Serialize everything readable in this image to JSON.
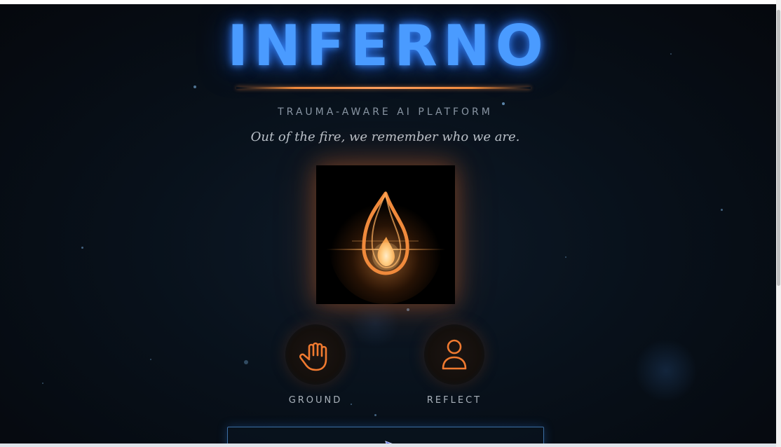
{
  "app": {
    "title": "INFERNO",
    "subtitle": "TRAUMA-AWARE AI PLATFORM",
    "tagline": "Out of the fire, we remember who we are."
  },
  "hero": {
    "icon": "flame-icon"
  },
  "actions": [
    {
      "label": "GROUND",
      "icon": "hand-icon"
    },
    {
      "label": "REFLECT",
      "icon": "person-icon"
    }
  ],
  "input": {
    "value": ""
  },
  "colors": {
    "title_blue": "#4a9bff",
    "accent_orange": "#f07a30",
    "background": "#08111b"
  }
}
